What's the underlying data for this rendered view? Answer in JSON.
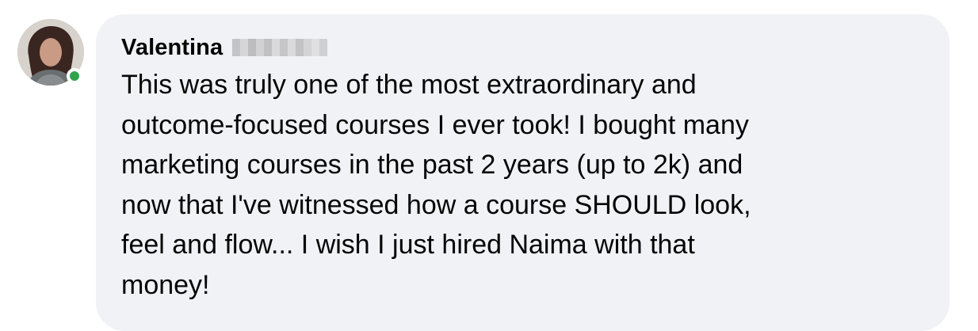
{
  "comment": {
    "author_first_name": "Valentina",
    "author_surname_redacted": true,
    "author_online": true,
    "text": "This was truly one of the most extraordinary and\noutcome-focused courses I ever took! I bought many\nmarketing courses in the past 2 years (up to 2k) and\nnow that I've witnessed how a course SHOULD look,\nfeel and flow... I wish I just hired Naima with that\nmoney!"
  },
  "colors": {
    "bubble_background": "#f0f2f5",
    "text": "#050505",
    "online_indicator": "#31a24c"
  },
  "icons": {
    "avatar": "user-avatar-photo",
    "presence": "online-status-dot"
  }
}
